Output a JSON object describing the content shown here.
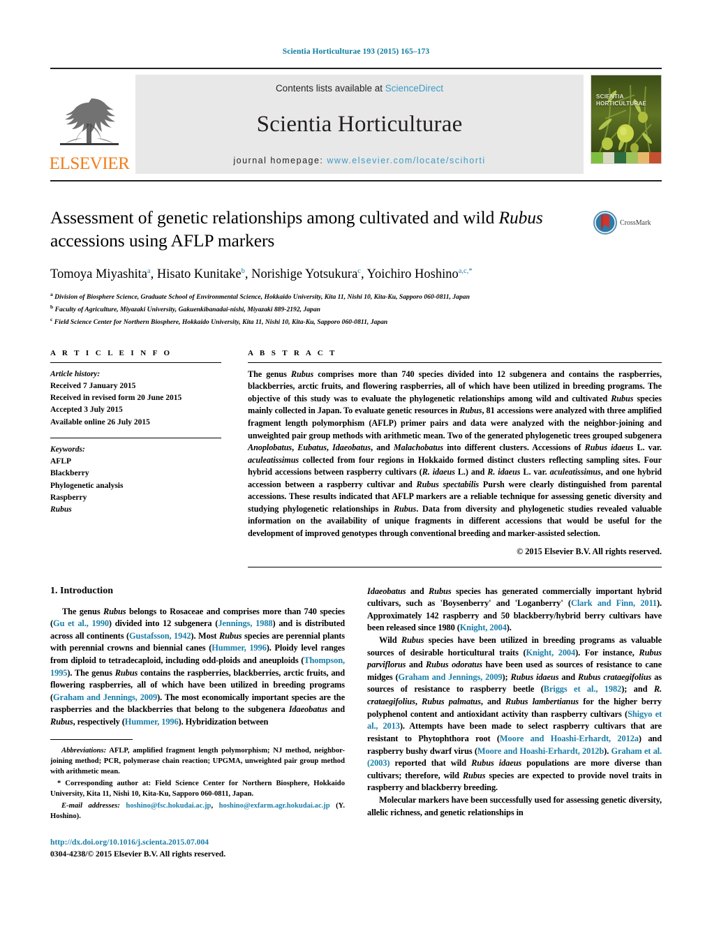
{
  "running_head": "Scientia Horticulturae 193 (2015) 165–173",
  "masthead": {
    "publisher_logo_word": "ELSEVIER",
    "contents_prefix": "Contents lists available at ",
    "contents_link": "ScienceDirect",
    "journal_name": "Scientia Horticulturae",
    "homepage_prefix": "journal homepage: ",
    "homepage_url": "www.elsevier.com/locate/scihorti",
    "cover_title_line1": "SCIENTIA",
    "cover_title_line2": "HORTICULTURAE"
  },
  "article": {
    "title_part1": "Assessment of genetic relationships among cultivated and wild ",
    "title_italic": "Rubus",
    "title_part2": " accessions using AFLP markers",
    "crossmark_label": "CrossMark",
    "authors_html": "Tomoya Miyashita<sup>a</sup>, Hisato Kunitake<sup>b</sup>, Norishige Yotsukura<sup>c</sup>, Yoichiro Hoshino<sup>a,c,</sup><sup class=\"star\">*</sup>",
    "affiliations": [
      {
        "mark": "a",
        "text": "Division of Biosphere Science, Graduate School of Environmental Science, Hokkaido University, Kita 11, Nishi 10, Kita-Ku, Sapporo 060-0811, Japan"
      },
      {
        "mark": "b",
        "text": "Faculty of Agriculture, Miyazaki University, Gakuenkibanadai-nishi, Miyazaki 889-2192, Japan"
      },
      {
        "mark": "c",
        "text": "Field Science Center for Northern Biosphere, Hokkaido University, Kita 11, Nishi 10, Kita-Ku, Sapporo 060-0811, Japan"
      }
    ]
  },
  "article_info": {
    "heading": "A R T I C L E   I N F O",
    "history_label": "Article history:",
    "history": [
      "Received 7 January 2015",
      "Received in revised form 20 June 2015",
      "Accepted 3 July 2015",
      "Available online 26 July 2015"
    ],
    "keywords_label": "Keywords:",
    "keywords": [
      "AFLP",
      "Blackberry",
      "Phylogenetic analysis",
      "Raspberry",
      "Rubus"
    ]
  },
  "abstract": {
    "heading": "A B S T R A C T",
    "text_html": "The genus <i>Rubus</i> comprises more than 740 species divided into 12 subgenera and contains the raspberries, blackberries, arctic fruits, and flowering raspberries, all of which have been utilized in breeding programs. The objective of this study was to evaluate the phylogenetic relationships among wild and cultivated <i>Rubus</i> species mainly collected in Japan. To evaluate genetic resources in <i>Rubus</i>, 81 accessions were analyzed with three amplified fragment length polymorphism (AFLP) primer pairs and data were analyzed with the neighbor-joining and unweighted pair group methods with arithmetic mean. Two of the generated phylogenetic trees grouped subgenera <i>Anoplobatus</i>, <i>Eubatus</i>, <i>Idaeobatus</i>, and <i>Malachobatus</i> into different clusters. Accessions of <i>Rubus idaeus</i> L. var. <i>aculeatissimus</i> collected from four regions in Hokkaido formed distinct clusters reflecting sampling sites. Four hybrid accessions between raspberry cultivars (<i>R. idaeus</i> L.) and <i>R. idaeus</i> L. var. <i>aculeatissimus</i>, and one hybrid accession between a raspberry cultivar and <i>Rubus spectabilis</i> Pursh were clearly distinguished from parental accessions. These results indicated that AFLP markers are a reliable technique for assessing genetic diversity and studying phylogenetic relationships in <i>Rubus</i>. Data from diversity and phylogenetic studies revealed valuable information on the availability of unique fragments in different accessions that would be useful for the development of improved genotypes through conventional breeding and marker-assisted selection.",
    "copyright": "© 2015 Elsevier B.V. All rights reserved."
  },
  "introduction": {
    "section_number_title": "1.  Introduction",
    "left_paragraph_html": "The genus <i>Rubus</i> belongs to Rosaceae and comprises more than 740 species (<span class=\"ref\">Gu et al., 1990</span>) divided into 12 subgenera (<span class=\"ref\">Jennings, 1988</span>) and is distributed across all continents (<span class=\"ref\">Gustafsson, 1942</span>). Most <i>Rubus</i> species are perennial plants with perennial crowns and biennial canes (<span class=\"ref\">Hummer, 1996</span>). Ploidy level ranges from diploid to tetradecaploid, including odd-ploids and aneuploids (<span class=\"ref\">Thompson, 1995</span>). The genus <i>Rubus</i> contains the raspberries, blackberries, arctic fruits, and flowering raspberries, all of which have been utilized in breeding programs (<span class=\"ref\">Graham and Jennings, 2009</span>). The most economically important species are the raspberries and the blackberries that belong to the subgenera <i>Idaeobatus</i> and <i>Rubus</i>, respectively (<span class=\"ref\">Hummer, 1996</span>). Hybridization between",
    "right_paragraph_1_html": "<i>Idaeobatus</i> and <i>Rubus</i> species has generated commercially important hybrid cultivars, such as 'Boysenberry' and 'Loganberry' (<span class=\"ref\">Clark and Finn, 2011</span>). Approximately 142 raspberry and 50 blackberry/hybrid berry cultivars have been released since 1980 (<span class=\"ref\">Knight, 2004</span>).",
    "right_paragraph_2_html": "Wild <i>Rubus</i> species have been utilized in breeding programs as valuable sources of desirable horticultural traits (<span class=\"ref\">Knight, 2004</span>). For instance, <i>Rubus parviflorus</i> and <i>Rubus odoratus</i> have been used as sources of resistance to cane midges (<span class=\"ref\">Graham and Jennings, 2009</span>); <i>Rubus idaeus</i> and <i>Rubus crataegifolius</i> as sources of resistance to raspberry beetle (<span class=\"ref\">Briggs et al., 1982</span>); and <i>R. crataegifolius</i>, <i>Rubus palmatus</i>, and <i>Rubus lambertianus</i> for the higher berry polyphenol content and antioxidant activity than raspberry cultivars (<span class=\"ref\">Shigyo et al., 2013</span>). Attempts have been made to select raspberry cultivars that are resistant to Phytophthora root (<span class=\"ref\">Moore and Hoashi-Erhardt, 2012a</span>) and raspberry bushy dwarf virus (<span class=\"ref\">Moore and Hoashi-Erhardt, 2012b</span>). <span class=\"ref\">Graham et al. (2003)</span> reported that wild <i>Rubus idaeus</i> populations are more diverse than cultivars; therefore, wild <i>Rubus</i> species are expected to provide novel traits in raspberry and blackberry breeding.",
    "right_paragraph_3_html": "Molecular markers have been successfully used for assessing genetic diversity, allelic richness, and genetic relationships in"
  },
  "footnotes": {
    "abbreviations_html": "<span class=\"ital\">Abbreviations:</span>   AFLP, amplified fragment length polymorphism; NJ method, neighbor-joining method; PCR, polymerase chain reaction; UPGMA, unweighted pair group method with arithmetic mean.",
    "corresponding_html": "* Corresponding author at: Field Science Center for Northern Biosphere, Hokkaido University, Kita 11, Nishi 10, Kita-Ku, Sapporo 060-0811, Japan.",
    "email_html": "<span class=\"ital\">E-mail addresses:</span> <span class=\"mail\">hoshino@fsc.hokudai.ac.jp</span>, <span class=\"mail\">hoshino@exfarm.agr.hokudai.ac.jp</span> (Y. Hoshino).",
    "doi": "http://dx.doi.org/10.1016/j.scienta.2015.07.004",
    "issn_html": "0304-4238/© 2015 Elsevier B.V. All rights reserved."
  },
  "colors": {
    "link": "#1a7ea8",
    "header_teal": "#0b7c9e",
    "elsevier_orange": "#ef7d1a",
    "masthead_bg": "#e8e8e8"
  }
}
